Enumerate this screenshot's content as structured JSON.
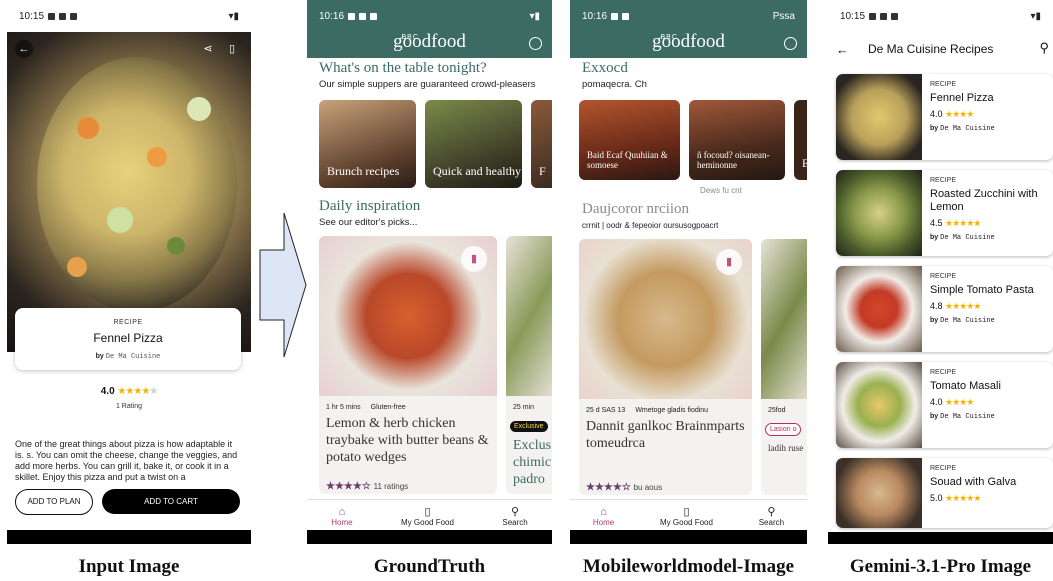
{
  "captions": [
    "Input Image",
    "GroundTruth",
    "Mobileworldmodel-Image",
    "Gemini-3.1-Pro Image"
  ],
  "input": {
    "time": "10:15",
    "kicker": "RECIPE",
    "title": "Fennel Pizza",
    "by": "by",
    "author": "De Ma Cuisine",
    "rating": "4.0",
    "stars": "★★★★",
    "star_off": "★",
    "rating_count": "1 Rating",
    "description": "One of the great things about pizza is how adaptable it is. s. You can omit the cheese, change the veggies, and add more herbs. You can grill it, bake it, or cook it in a skillet. Enjoy this pizza and put a twist on a",
    "add_to_plan": "ADD TO PLAN",
    "add_to_cart": "ADD TO CART"
  },
  "groundtruth": {
    "time": "10:16",
    "logo_small": "BBC",
    "logo": "goodfood",
    "section1_title": "What's on the table tonight?",
    "section1_sub": "Our simple suppers are guaranteed crowd-pleasers",
    "tiles": [
      "Brunch recipes",
      "Quick and healthy",
      "F"
    ],
    "section2_title": "Daily inspiration",
    "section2_sub": "See our editor's picks...",
    "card1_time": "1 hr 5 mins",
    "card1_diet": "Gluten-free",
    "card1_title": "Lemon & herb chicken traybake with butter beans & potato wedges",
    "card1_stars": "★★★★☆",
    "card1_ratings": "11 ratings",
    "card2_time": "25 min",
    "card2_badge": "Exclusive",
    "card2_title": "Exclus chimic padro",
    "nav": [
      "Home",
      "My Good Food",
      "Search"
    ]
  },
  "mobileworld": {
    "time": "10:16",
    "corner": "Pssa",
    "logo_small": "BBC",
    "logo": "goodfood",
    "section1_title": "Exxocd",
    "section1_sub": "pomaqecra. Ch",
    "tiles": [
      "Baid Ecaf Quuhiian & somoese",
      "ñ focoud? oisanean-heminonne",
      "E"
    ],
    "icons_row": "Dews fu cnt",
    "section2_title": "Daujcoror nrciion",
    "section2_sub": "crrnit | oodr & fepeoior oursusogpoacrt",
    "card1_time": "25 d SAS 13",
    "card1_diet": "Wmetoge gladis fiodinu",
    "card1_title": "Dannit ganlkoc Brainmparts tomeudrca",
    "card1_stars": "★★★★☆",
    "card1_ratings": "bu aous",
    "card2_time": "25fod",
    "card2_badge": "Lasion o",
    "card2_title": "ladih ruse",
    "nav": [
      "Home",
      "My Good Food",
      "Search"
    ]
  },
  "gemini": {
    "time": "10:15",
    "app_title": "De Ma Cuisine Recipes",
    "recipes": [
      {
        "kicker": "RECIPE",
        "name": "Fennel Pizza",
        "rating": "4.0",
        "stars": "★★★★",
        "by": "by",
        "author": "De Ma Cuisine"
      },
      {
        "kicker": "RECIPE",
        "name": "Roasted Zucchini with Lemon",
        "rating": "4.5",
        "stars": "★★★★★",
        "by": "by",
        "author": "De Ma Cuisine"
      },
      {
        "kicker": "RECIPE",
        "name": "Simple Tomato Pasta",
        "rating": "4.8",
        "stars": "★★★★★",
        "by": "by",
        "author": "De Ma Cuisine"
      },
      {
        "kicker": "RECIPE",
        "name": "Tomato Masali",
        "rating": "4.0",
        "stars": "★★★★",
        "by": "by",
        "author": "De Ma Cuisine"
      },
      {
        "kicker": "RECIPE",
        "name": "Souad with Galva",
        "rating": "5.0",
        "stars": "★★★★★",
        "by": "",
        "author": ""
      }
    ]
  }
}
